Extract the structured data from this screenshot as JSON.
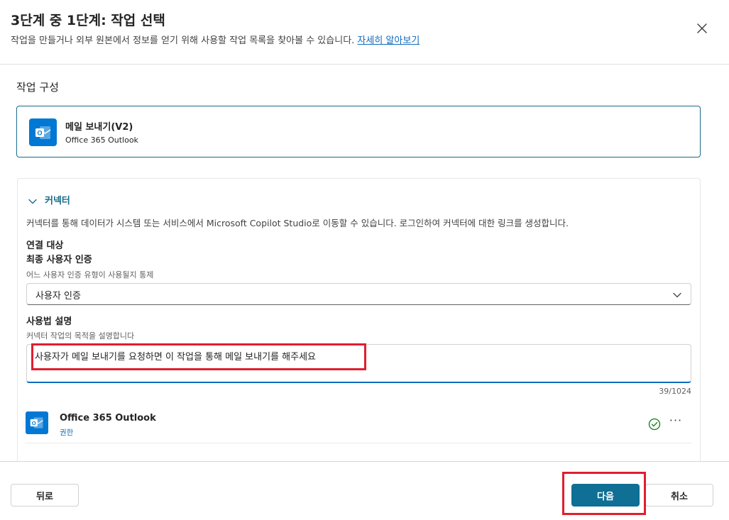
{
  "header": {
    "title": "3단계 중 1단계: 작업 선택",
    "subtitle": "작업을 만들거나 외부 원본에서 정보를 얻기 위해 사용할 작업 목록을 찾아볼 수 있습니다.",
    "learn_more": "자세히 알아보기"
  },
  "content": {
    "section_title": "작업 구성",
    "action": {
      "name": "메일 보내기(V2)",
      "connector": "Office 365 Outlook",
      "icon": "outlook-icon"
    },
    "connector_panel": {
      "label": "커넥터",
      "description": "커넥터를 통해 데이터가 시스템 또는 서비스에서 Microsoft Copilot Studio로 이동할 수 있습니다. 로그인하여 커넥터에 대한 링크를 생성합니다.",
      "connection_target": "연결 대상",
      "auth_title": "최종 사용자 인증",
      "auth_hint": "어느 사용자 인증 유형이 사용될지 통제",
      "auth_value": "사용자 인증",
      "usage_title": "사용법 설명",
      "usage_hint": "커넥터 작업의 목적을 설명합니다",
      "usage_value": "사용자가 메일 보내기를 요청하면 이 작업을 통해 메일 보내기를 해주세요",
      "char_count": "39/1024",
      "connection": {
        "name": "Office 365 Outlook",
        "permission": "권한",
        "status_icon": "check-circle-icon",
        "more": "···"
      }
    }
  },
  "footer": {
    "back": "뒤로",
    "next": "다음",
    "cancel": "취소"
  },
  "colors": {
    "accent": "#0f6f94",
    "link": "#0f6cbd",
    "highlight": "#e01e2e",
    "success": "#107c10"
  }
}
